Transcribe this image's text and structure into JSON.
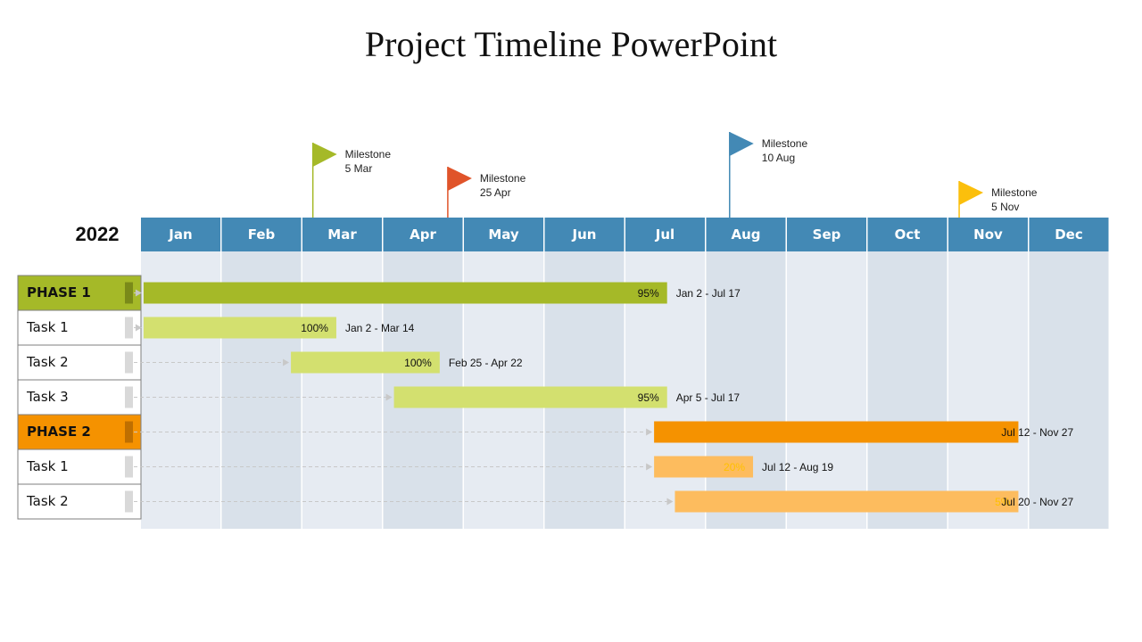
{
  "title": "Project Timeline PowerPoint",
  "chart_data": {
    "type": "gantt",
    "title": "Project Timeline PowerPoint",
    "year": "2022",
    "months": [
      "Jan",
      "Feb",
      "Mar",
      "Apr",
      "May",
      "Jun",
      "Jul",
      "Aug",
      "Sep",
      "Oct",
      "Nov",
      "Dec"
    ],
    "colors": {
      "header": "#4389b5",
      "band_light": "#e6ebf2",
      "band_dark": "#d9e1ea",
      "phase1": "#a5b928",
      "phase1_task": "#d3e06f",
      "phase2": "#f59200",
      "phase2_task": "#fdbc5e"
    },
    "milestones": [
      {
        "label": "Milestone",
        "date": "5 Mar",
        "month": 3,
        "day": 5,
        "color": "#a5b928"
      },
      {
        "label": "Milestone",
        "date": "25 Apr",
        "month": 4,
        "day": 25,
        "color": "#e0542a"
      },
      {
        "label": "Milestone",
        "date": "10 Aug",
        "month": 8,
        "day": 10,
        "color": "#4389b5"
      },
      {
        "label": "Milestone",
        "date": "5 Nov",
        "month": 11,
        "day": 5,
        "color": "#fbbf0c"
      }
    ],
    "rows": [
      {
        "name": "PHASE 1",
        "kind": "phase",
        "group": 1,
        "start": [
          1,
          2
        ],
        "end": [
          7,
          17
        ],
        "progress": "95%",
        "range": "Jan 2 - Jul 17"
      },
      {
        "name": "Task 1",
        "kind": "task",
        "group": 1,
        "start": [
          1,
          2
        ],
        "end": [
          3,
          14
        ],
        "progress": "100%",
        "range": "Jan 2 - Mar 14"
      },
      {
        "name": "Task 2",
        "kind": "task",
        "group": 1,
        "start": [
          2,
          25
        ],
        "end": [
          4,
          22
        ],
        "progress": "100%",
        "range": "Feb 25 - Apr 22"
      },
      {
        "name": "Task 3",
        "kind": "task",
        "group": 1,
        "start": [
          4,
          5
        ],
        "end": [
          7,
          17
        ],
        "progress": "95%",
        "range": "Apr 5 - Jul 17"
      },
      {
        "name": "PHASE 2",
        "kind": "phase",
        "group": 2,
        "start": [
          7,
          12
        ],
        "end": [
          11,
          27
        ],
        "progress": "",
        "range": "Jul 12 - Nov 27"
      },
      {
        "name": "Task 1",
        "kind": "task",
        "group": 2,
        "start": [
          7,
          12
        ],
        "end": [
          8,
          19
        ],
        "progress": "20%",
        "range": "Jul 12 - Aug 19"
      },
      {
        "name": "Task 2",
        "kind": "task",
        "group": 2,
        "start": [
          7,
          20
        ],
        "end": [
          11,
          27
        ],
        "progress": "5%",
        "range": "Jul 20 - Nov 27"
      }
    ]
  }
}
